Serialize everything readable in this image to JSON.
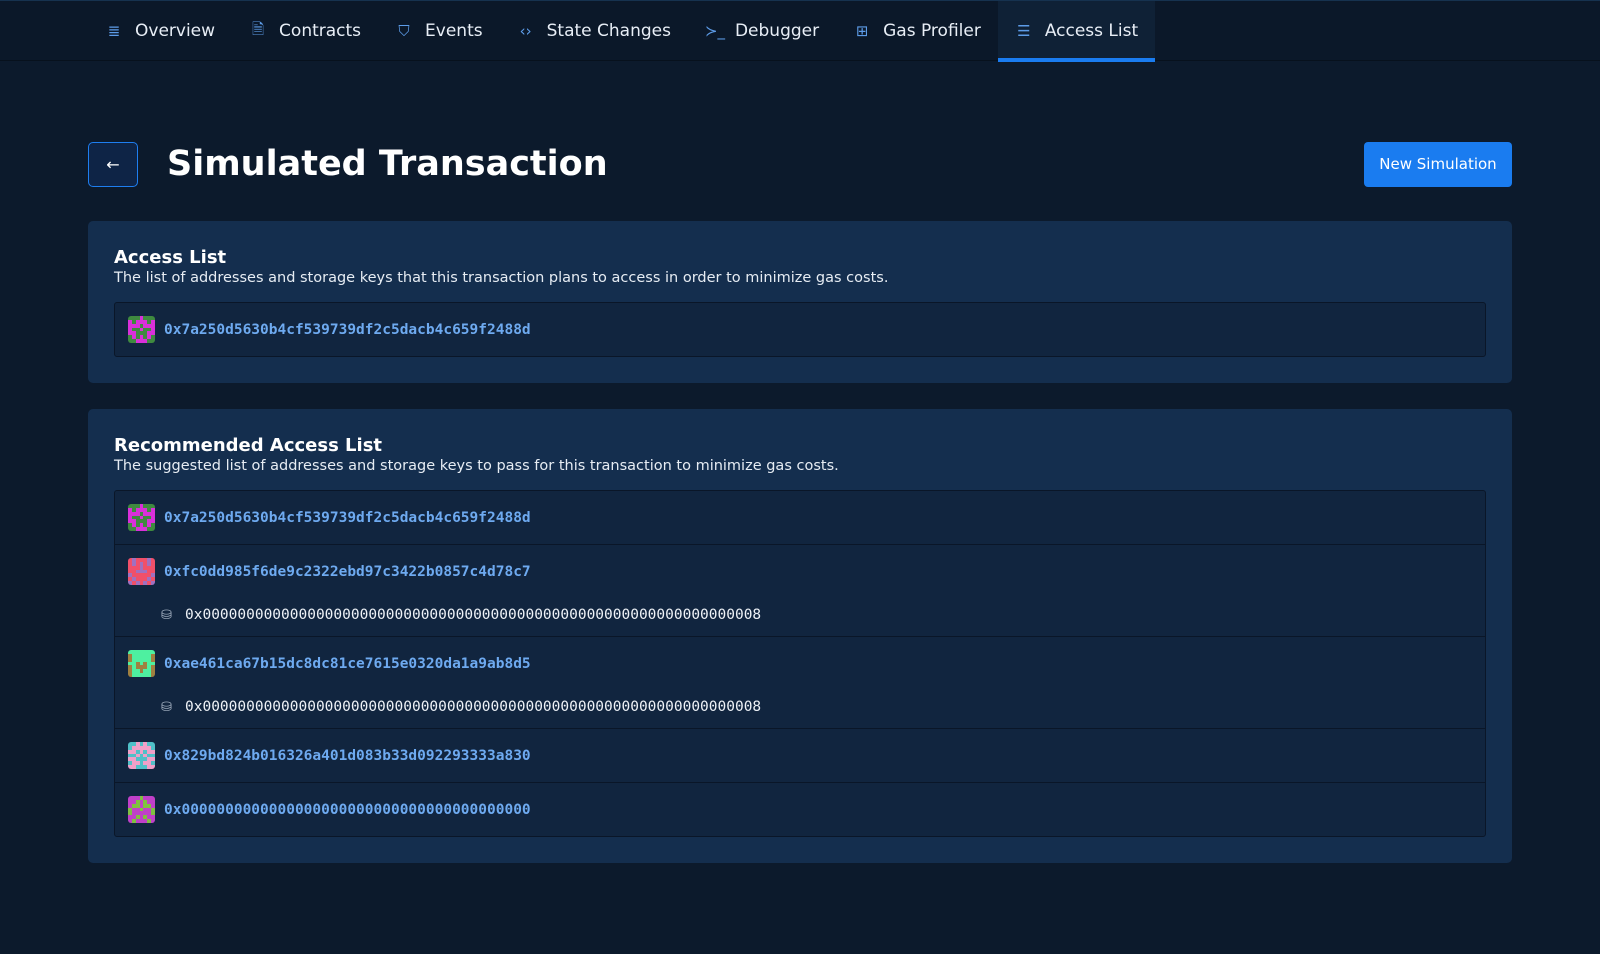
{
  "nav": {
    "tabs": [
      {
        "label": "Overview",
        "icon": "list-icon",
        "glyph": "≣"
      },
      {
        "label": "Contracts",
        "icon": "document-icon",
        "glyph": "🗎"
      },
      {
        "label": "Events",
        "icon": "bookmark-icon",
        "glyph": "⛉"
      },
      {
        "label": "State Changes",
        "icon": "code-icon",
        "glyph": "‹›"
      },
      {
        "label": "Debugger",
        "icon": "terminal-icon",
        "glyph": "≻_"
      },
      {
        "label": "Gas Profiler",
        "icon": "chip-icon",
        "glyph": "⊞"
      },
      {
        "label": "Access List",
        "icon": "list-bullets-icon",
        "glyph": "☰"
      }
    ],
    "active": 6
  },
  "header": {
    "back_glyph": "←",
    "title": "Simulated Transaction",
    "new_simulation": "New Simulation"
  },
  "access_list": {
    "title": "Access List",
    "description": "The list of addresses and storage keys that this transaction plans to access in order to minimize gas costs.",
    "items": [
      {
        "address": "0x7a250d5630b4cf539739df2c5dacb4c659f2488d",
        "colors": [
          "#d930d9",
          "#3f8a3f"
        ],
        "keys": []
      }
    ]
  },
  "recommended": {
    "title": "Recommended Access List",
    "description": "The suggested list of addresses and storage keys to pass for this transaction to minimize gas costs.",
    "items": [
      {
        "address": "0x7a250d5630b4cf539739df2c5dacb4c659f2488d",
        "colors": [
          "#d930d9",
          "#3f8a3f"
        ],
        "keys": []
      },
      {
        "address": "0xfc0dd985f6de9c2322ebd97c3422b0857c4d78c7",
        "colors": [
          "#f0506a",
          "#a070c0"
        ],
        "keys": [
          "0x0000000000000000000000000000000000000000000000000000000000000008"
        ]
      },
      {
        "address": "0xae461ca67b15dc8dc81ce7615e0320da1a9ab8d5",
        "colors": [
          "#4ef0a0",
          "#a08040"
        ],
        "keys": [
          "0x0000000000000000000000000000000000000000000000000000000000000008"
        ]
      },
      {
        "address": "0x829bd824b016326a401d083b33d092293333a830",
        "colors": [
          "#50c0c8",
          "#f0a0c8"
        ],
        "keys": []
      },
      {
        "address": "0x0000000000000000000000000000000000000000",
        "colors": [
          "#c040c8",
          "#80c040"
        ],
        "keys": []
      }
    ]
  }
}
